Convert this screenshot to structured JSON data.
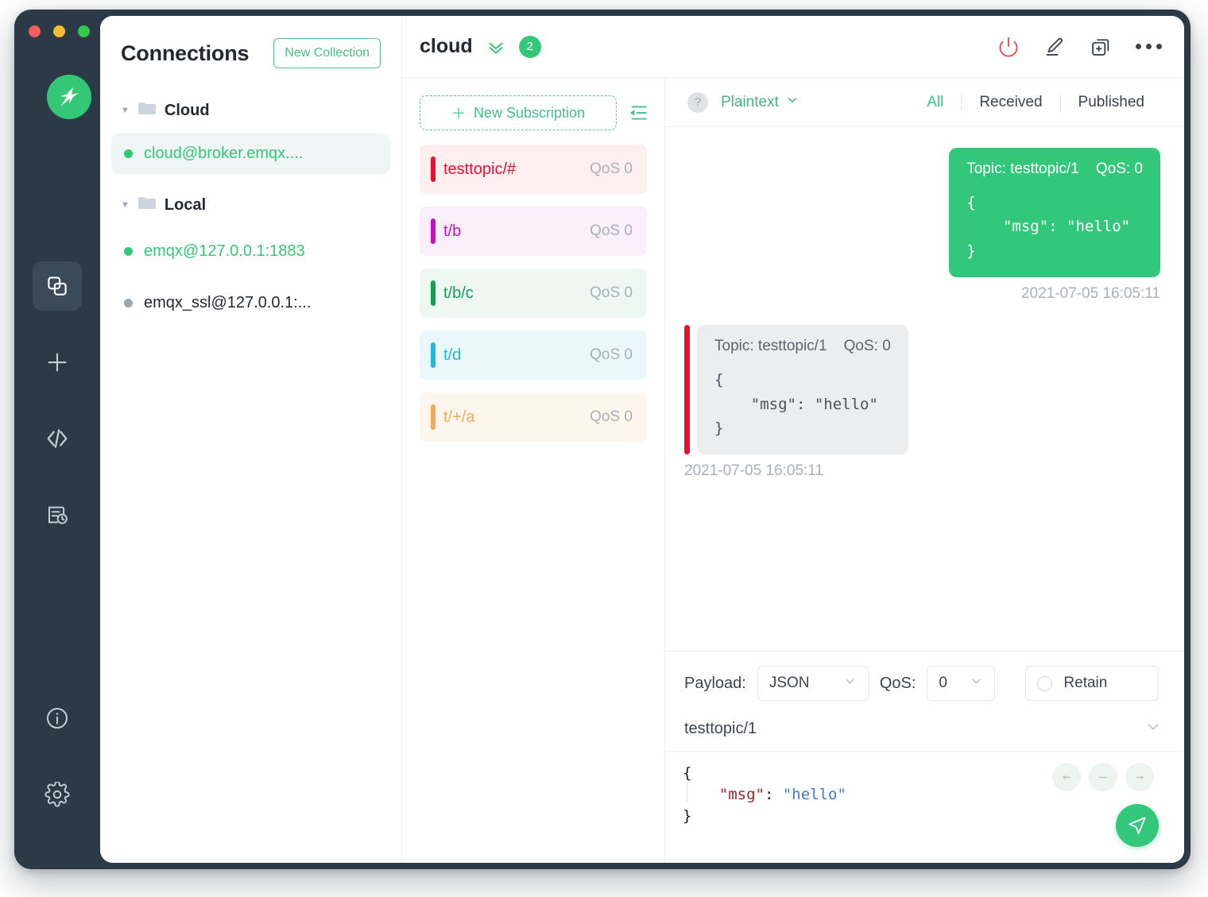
{
  "window": {
    "traffic_lights": [
      "close",
      "minimize",
      "maximize"
    ],
    "accent_green": "#34c777",
    "dark_rail": "#2c3a48"
  },
  "rail": {
    "logo_name": "mqttx-logo",
    "items": [
      {
        "icon": "connections-icon",
        "name": "sidebar-item-connections",
        "active": true
      },
      {
        "icon": "plus-icon",
        "name": "sidebar-item-new-connection",
        "active": false
      },
      {
        "icon": "code-icon",
        "name": "sidebar-item-scripts",
        "active": false
      },
      {
        "icon": "log-clock-icon",
        "name": "sidebar-item-log",
        "active": false
      }
    ],
    "bottom_items": [
      {
        "icon": "info-icon",
        "name": "sidebar-item-about"
      },
      {
        "icon": "gear-icon",
        "name": "sidebar-item-settings"
      }
    ]
  },
  "connections": {
    "title": "Connections",
    "new_collection_label": "New Collection",
    "groups": [
      {
        "name": "Cloud",
        "expanded": true,
        "items": [
          {
            "label": "cloud@broker.emqx....",
            "status": "on",
            "selected": true
          }
        ]
      },
      {
        "name": "Local",
        "expanded": true,
        "items": [
          {
            "label": "emqx@127.0.0.1:1883",
            "status": "on",
            "selected": false
          },
          {
            "label": "emqx_ssl@127.0.0.1:...",
            "status": "off",
            "selected": false
          }
        ]
      }
    ]
  },
  "topbar": {
    "title": "cloud",
    "expand_icon": "chevron-double-down-icon",
    "badge_count": "2",
    "actions": [
      {
        "icon": "power-icon",
        "name": "disconnect-button",
        "color": "#e8535a"
      },
      {
        "icon": "edit-pencil-icon",
        "name": "edit-connection-button",
        "color": "#3b4450"
      },
      {
        "icon": "new-window-plus-icon",
        "name": "new-window-button",
        "color": "#3b4450"
      },
      {
        "icon": "more-horizontal-icon",
        "name": "more-options-button",
        "color": "#3b4450"
      }
    ]
  },
  "subscriptions": {
    "new_subscription_label": "New Subscription",
    "collapse_icon": "collapse-list-icon",
    "items": [
      {
        "topic": "testtopic/#",
        "qos": "QoS 0",
        "color": "#e8112d",
        "bg": "#fdeef0"
      },
      {
        "topic": "t/b",
        "qos": "QoS 0",
        "color": "#c40fc4",
        "bg": "#fbeffb"
      },
      {
        "topic": "t/b/c",
        "qos": "QoS 0",
        "color": "#0f9d58",
        "bg": "#eef7f1"
      },
      {
        "topic": "t/d",
        "qos": "QoS 0",
        "color": "#22b8d6",
        "bg": "#eaf8fb"
      },
      {
        "topic": "t/+/a",
        "qos": "QoS 0",
        "color": "#f0ac5a",
        "bg": "#fdf6ec"
      }
    ]
  },
  "messages": {
    "toolbar": {
      "help_icon": "question-mark-icon",
      "format_label": "Plaintext",
      "format_chevron": "chevron-down-icon",
      "filters": [
        {
          "label": "All",
          "active": true
        },
        {
          "label": "Received",
          "active": false
        },
        {
          "label": "Published",
          "active": false
        }
      ]
    },
    "list": [
      {
        "direction": "out",
        "meta": "Topic: testtopic/1    QoS: 0",
        "payload": "{\n    \"msg\": \"hello\"\n}",
        "time": "2021-07-05 16:05:11"
      },
      {
        "direction": "in",
        "bar_color": "#e8112d",
        "meta": "Topic: testtopic/1    QoS: 0",
        "payload": "{\n    \"msg\": \"hello\"\n}",
        "time": "2021-07-05 16:05:11"
      }
    ]
  },
  "publish": {
    "payload_label": "Payload:",
    "payload_value": "JSON",
    "qos_label": "QoS:",
    "qos_value": "0",
    "retain_label": "Retain",
    "retain_checked": false,
    "topic_value": "testtopic/1",
    "topic_chevron": "chevron-down-icon",
    "editor": {
      "line1": "{",
      "key": "\"msg\"",
      "colon": ": ",
      "value": "\"hello\"",
      "line3": "}"
    },
    "nav": [
      {
        "icon": "arrow-left-icon",
        "name": "prev-payload-button"
      },
      {
        "icon": "minus-icon",
        "name": "clear-payload-button"
      },
      {
        "icon": "arrow-right-icon",
        "name": "next-payload-button"
      }
    ],
    "send_icon": "send-paper-plane-icon"
  }
}
